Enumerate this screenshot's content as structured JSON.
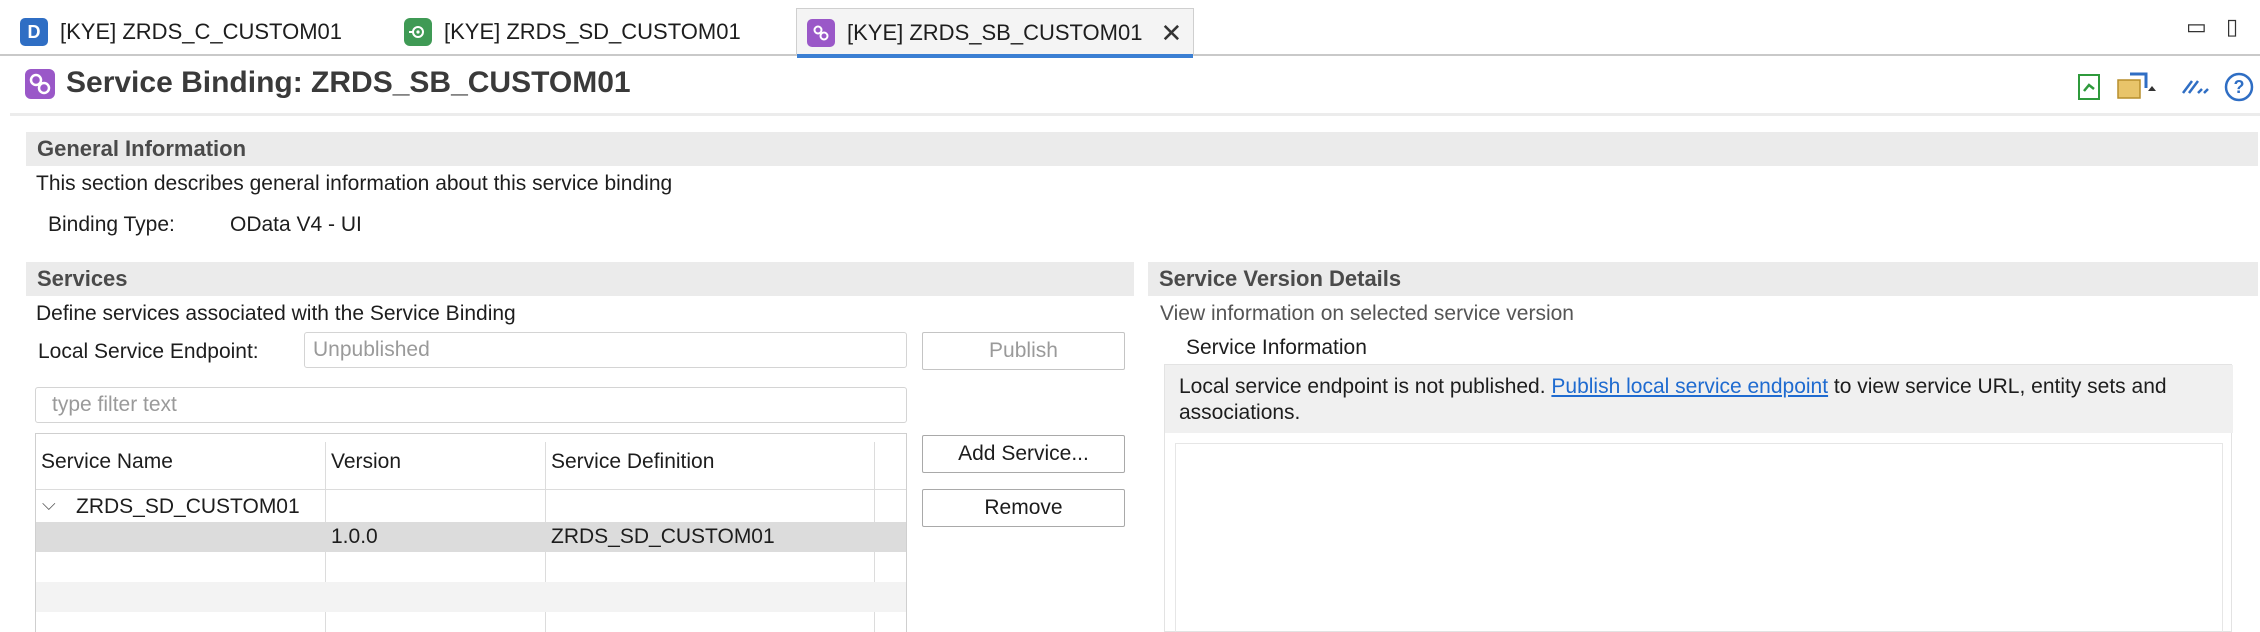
{
  "tabs": [
    {
      "label": "[KYE] ZRDS_C_CUSTOM01",
      "icon": "data-definition-icon",
      "icon_glyph": "D",
      "color": "#2f6ec4",
      "active": false
    },
    {
      "label": "[KYE] ZRDS_SD_CUSTOM01",
      "icon": "service-definition-icon",
      "icon_glyph": "⊙",
      "color": "#3f9a55",
      "active": false
    },
    {
      "label": "[KYE] ZRDS_SB_CUSTOM01",
      "icon": "service-binding-icon",
      "icon_glyph": "∞",
      "color": "#9a58c8",
      "active": true
    }
  ],
  "window": {
    "minimize": "▭",
    "maximize": "▯"
  },
  "editor": {
    "title": "Service Binding: ZRDS_SB_CUSTOM01",
    "title_icon": "service-binding-icon",
    "toolbar": [
      "refresh-icon",
      "share-icon",
      "link-icon",
      "help-icon"
    ],
    "help_glyph": "?"
  },
  "general": {
    "heading": "General Information",
    "description": "This section describes general information about this service binding",
    "binding_type_label": "Binding Type:",
    "binding_type_value": "OData V4 - UI"
  },
  "services": {
    "heading": "Services",
    "description": "Define services associated with the Service Binding",
    "endpoint_label": "Local Service Endpoint:",
    "endpoint_value": "Unpublished",
    "publish_label": "Publish",
    "filter_placeholder": "type filter text",
    "add_service_label": "Add Service...",
    "remove_label": "Remove",
    "columns": [
      "Service Name",
      "Version",
      "Service Definition"
    ],
    "rows": [
      {
        "name": "ZRDS_SD_CUSTOM01",
        "version": "",
        "definition": "",
        "expanded": true
      },
      {
        "name": "",
        "version": "1.0.0",
        "definition": "ZRDS_SD_CUSTOM01",
        "selected": true
      }
    ]
  },
  "version_details": {
    "heading": "Service Version Details",
    "description": "View information on selected service version",
    "info_heading": "Service Information",
    "message_prefix": "Local service endpoint is not published. ",
    "message_link": "Publish local service endpoint",
    "message_suffix": " to view service URL, entity sets and associations."
  }
}
